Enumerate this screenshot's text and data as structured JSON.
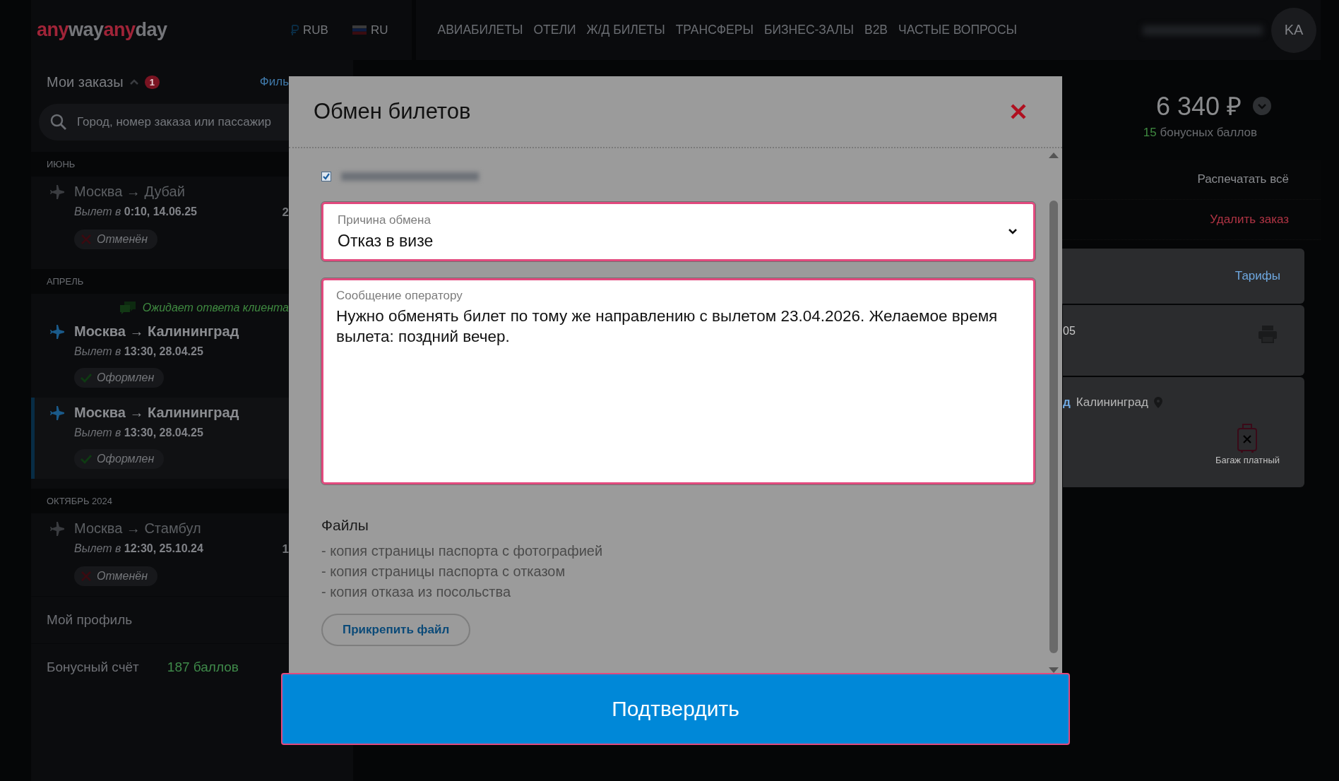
{
  "header": {
    "logo": [
      {
        "text": "any",
        "accent": true
      },
      {
        "text": "way",
        "accent": false
      },
      {
        "text": "any",
        "accent": true
      },
      {
        "text": "day",
        "accent": false
      }
    ],
    "currency": "RUB",
    "language": "RU",
    "nav": [
      "АВИАБИЛЕТЫ",
      "ОТЕЛИ",
      "Ж/Д БИЛЕТЫ",
      "ТРАНСФЕРЫ",
      "БИЗНЕС-ЗАЛЫ",
      "B2B",
      "ЧАСТЫЕ ВОПРОСЫ"
    ],
    "avatar": "KA"
  },
  "sidebar": {
    "title": "Мои заказы",
    "expanded": true,
    "badge": "1",
    "filter_link": "Филь",
    "search": {
      "placeholder": "Город, номер заказа или пассажир"
    },
    "groups": [
      {
        "month": "ИЮНЬ",
        "orders": [
          {
            "route": "Москва → Дубай",
            "departure_label": "Вылет в",
            "departure_time": "0:10, 14.06.25",
            "price": "2",
            "status": "Отменён",
            "kind": "cancelled",
            "selected": false
          }
        ]
      },
      {
        "month": "АПРЕЛЬ",
        "orders": [
          {
            "note": "Ожидает ответа клиента",
            "route": "Москва → Калининград",
            "departure_label": "Вылет в",
            "departure_time": "13:30, 28.04.25",
            "status": "Оформлен",
            "kind": "issued",
            "selected": false
          },
          {
            "route": "Москва → Калининград",
            "departure_label": "Вылет в",
            "departure_time": "13:30, 28.04.25",
            "status": "Оформлен",
            "kind": "issued",
            "selected": true
          }
        ]
      },
      {
        "month": "ОКТЯБРЬ 2024",
        "orders": [
          {
            "route": "Москва → Стамбул",
            "departure_label": "Вылет в",
            "departure_time": "12:30, 25.10.24",
            "price": "1",
            "status": "Отменён",
            "kind": "cancelled",
            "selected": false
          }
        ]
      }
    ],
    "links": [
      {
        "label": "Мой профиль"
      },
      {
        "label": "Бонусный счёт",
        "value": "187 баллов"
      }
    ]
  },
  "order": {
    "total": "6 340 ₽",
    "bonus_points": "15",
    "bonus_label": "бонусных баллов",
    "actions": [
      {
        "label": "Распечатать всё",
        "kind": "normal"
      },
      {
        "label": "Удалить заказ",
        "kind": "danger"
      }
    ],
    "tariffs_link": "Тарифы",
    "flight_fragment": "05",
    "destination_prefix": "д",
    "destination": "Калининград",
    "baggage": "Багаж платный"
  },
  "modal": {
    "title": "Обмен билетов",
    "passenger_checked": true,
    "reason": {
      "label": "Причина обмена",
      "value": "Отказ в визе"
    },
    "message": {
      "label": "Сообщение оператору",
      "value": "Нужно обменять билет по тому же направлению с вылетом 23.04.2026. Желаемое время вылета: поздний вечер."
    },
    "files_title": "Файлы",
    "files": [
      "- копия страницы паспорта с фотографией",
      "- копия страницы паспорта с отказом",
      "- копия отказа из посольства"
    ],
    "attach_button": "Прикрепить файл",
    "confirm_button": "Подтвердить"
  }
}
